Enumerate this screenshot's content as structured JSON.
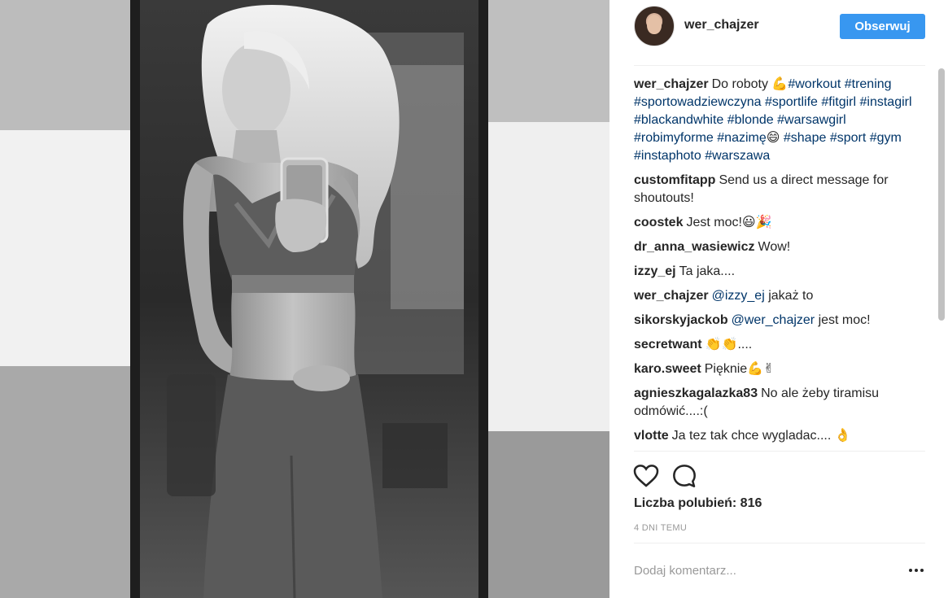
{
  "post": {
    "username": "wer_chajzer",
    "follow_label": "Obserwuj",
    "caption": {
      "user": "wer_chajzer",
      "parts": [
        {
          "t": "Do roboty 💪"
        },
        {
          "t": "#workout",
          "tag": true
        },
        {
          "t": " "
        },
        {
          "t": "#trening",
          "tag": true
        },
        {
          "t": " "
        },
        {
          "t": "#sportowadziewczyna",
          "tag": true
        },
        {
          "t": " "
        },
        {
          "t": "#sportlife",
          "tag": true
        },
        {
          "t": " "
        },
        {
          "t": "#fitgirl",
          "tag": true
        },
        {
          "t": " "
        },
        {
          "t": "#instagirl",
          "tag": true
        },
        {
          "t": " "
        },
        {
          "t": "#blackandwhite",
          "tag": true
        },
        {
          "t": " "
        },
        {
          "t": "#blonde",
          "tag": true
        },
        {
          "t": " "
        },
        {
          "t": "#warsawgirl",
          "tag": true
        },
        {
          "t": " "
        },
        {
          "t": "#robimyforme",
          "tag": true
        },
        {
          "t": " "
        },
        {
          "t": "#nazimę",
          "tag": true
        },
        {
          "t": "😄 "
        },
        {
          "t": "#shape",
          "tag": true
        },
        {
          "t": " "
        },
        {
          "t": "#sport",
          "tag": true
        },
        {
          "t": " "
        },
        {
          "t": "#gym",
          "tag": true
        },
        {
          "t": " "
        },
        {
          "t": "#instaphoto",
          "tag": true
        },
        {
          "t": " "
        },
        {
          "t": "#warszawa",
          "tag": true
        }
      ]
    },
    "comments": [
      {
        "user": "customfitapp",
        "parts": [
          {
            "t": "Send us a direct message for shoutouts!"
          }
        ]
      },
      {
        "user": "coostek",
        "parts": [
          {
            "t": "Jest moc!😃🎉"
          }
        ]
      },
      {
        "user": "dr_anna_wasiewicz",
        "parts": [
          {
            "t": "Wow!"
          }
        ]
      },
      {
        "user": "izzy_ej",
        "parts": [
          {
            "t": "Ta jaka...."
          }
        ]
      },
      {
        "user": "wer_chajzer",
        "parts": [
          {
            "t": "@izzy_ej",
            "tag": true
          },
          {
            "t": " jakaż to"
          }
        ]
      },
      {
        "user": "sikorskyjackob",
        "parts": [
          {
            "t": "@wer_chajzer",
            "tag": true
          },
          {
            "t": " jest moc!"
          }
        ]
      },
      {
        "user": "secretwant",
        "parts": [
          {
            "t": "👏👏...."
          }
        ]
      },
      {
        "user": "karo.sweet",
        "parts": [
          {
            "t": "Pięknie💪✌"
          }
        ]
      },
      {
        "user": "agnieszkagalazka83",
        "parts": [
          {
            "t": "No ale żeby tiramisu odmówić....:("
          }
        ]
      },
      {
        "user": "vlotte",
        "parts": [
          {
            "t": "Ja tez tak chce wygladac.... 👌"
          }
        ]
      }
    ],
    "likes_text": "Liczba polubień: 816",
    "time_ago": "4 DNI TEMU",
    "comment_placeholder": "Dodaj komentarz..."
  },
  "colors": {
    "follow_button": "#3897f0",
    "hashtag": "#003569",
    "timestamp": "#999999"
  },
  "icons": {
    "like": "heart-outline-icon",
    "comment": "speech-bubble-icon",
    "more": "more-options-icon"
  }
}
